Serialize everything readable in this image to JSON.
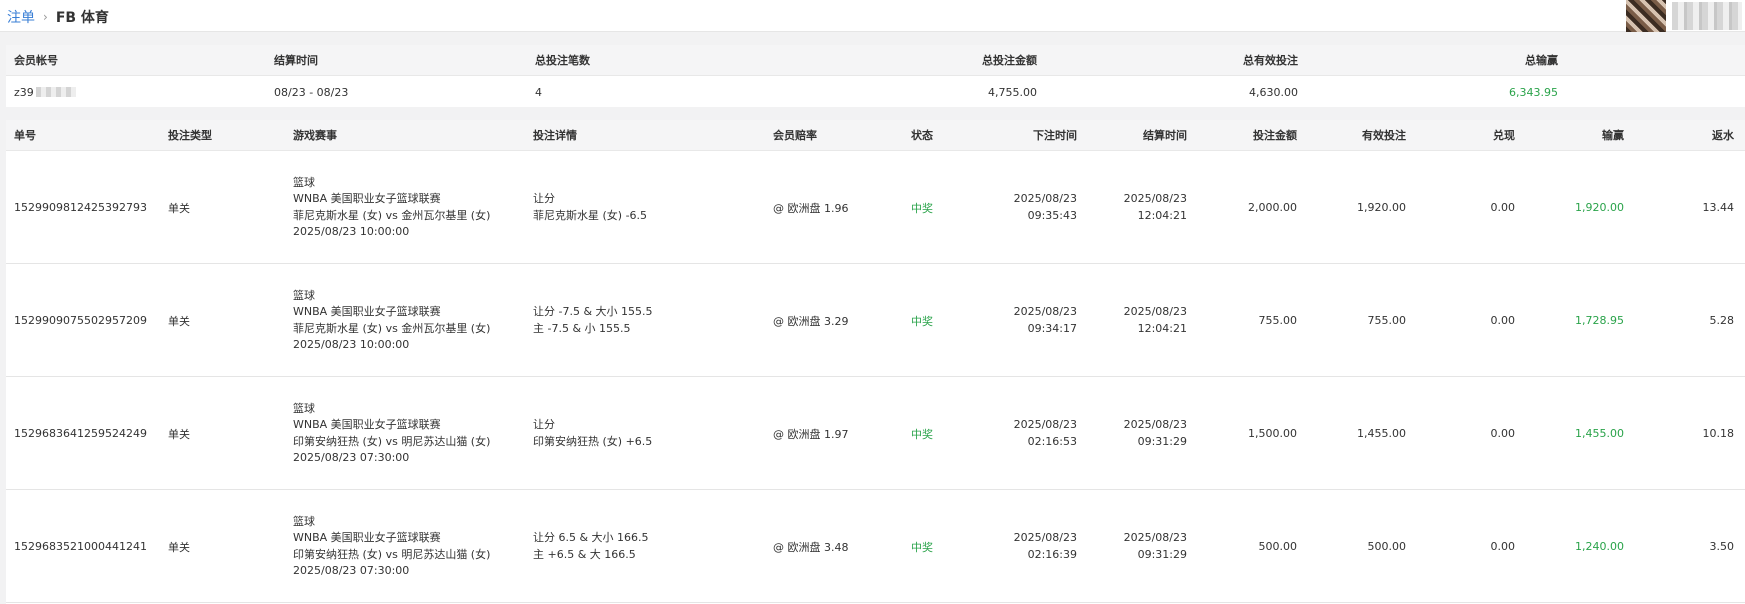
{
  "breadcrumb": {
    "parent": "注单",
    "separator": "›",
    "current": "FB 体育"
  },
  "summary": {
    "headers": {
      "account": "会员帐号",
      "settle_time": "结算时间",
      "total_bets": "总投注笔数",
      "total_amount": "总投注金额",
      "total_valid": "总有效投注",
      "total_winloss": "总输赢"
    },
    "row": {
      "account": "z39",
      "settle_time": "08/23 - 08/23",
      "total_bets": "4",
      "total_amount": "4,755.00",
      "total_valid": "4,630.00",
      "total_winloss": "6,343.95"
    }
  },
  "table": {
    "headers": {
      "id": "单号",
      "type": "投注类型",
      "event": "游戏赛事",
      "details": "投注详情",
      "odds": "会员赔率",
      "status": "状态",
      "bet_time": "下注时间",
      "settle_time": "结算时间",
      "amount": "投注金额",
      "valid": "有效投注",
      "cashout": "兑现",
      "winloss": "输赢",
      "rebate": "返水"
    },
    "rows": [
      {
        "id": "1529909812425392793",
        "type": "单关",
        "event": [
          "篮球",
          "WNBA 美国职业女子篮球联赛",
          "菲尼克斯水星 (女) vs 金州瓦尔基里 (女)",
          "2025/08/23 10:00:00"
        ],
        "details": [
          "让分",
          "菲尼克斯水星 (女) -6.5"
        ],
        "odds": "@ 欧洲盘 1.96",
        "status": "中奖",
        "bet_time": [
          "2025/08/23",
          "09:35:43"
        ],
        "settle_time": [
          "2025/08/23",
          "12:04:21"
        ],
        "amount": "2,000.00",
        "valid": "1,920.00",
        "cashout": "0.00",
        "winloss": "1,920.00",
        "rebate": "13.44"
      },
      {
        "id": "1529909075502957209",
        "type": "单关",
        "event": [
          "篮球",
          "WNBA 美国职业女子篮球联赛",
          "菲尼克斯水星 (女) vs 金州瓦尔基里 (女)",
          "2025/08/23 10:00:00"
        ],
        "details": [
          "让分 -7.5 & 大小 155.5",
          "主 -7.5 & 小 155.5"
        ],
        "odds": "@ 欧洲盘 3.29",
        "status": "中奖",
        "bet_time": [
          "2025/08/23",
          "09:34:17"
        ],
        "settle_time": [
          "2025/08/23",
          "12:04:21"
        ],
        "amount": "755.00",
        "valid": "755.00",
        "cashout": "0.00",
        "winloss": "1,728.95",
        "rebate": "5.28"
      },
      {
        "id": "1529683641259524249",
        "type": "单关",
        "event": [
          "篮球",
          "WNBA 美国职业女子篮球联赛",
          "印第安纳狂热 (女) vs 明尼苏达山猫 (女)",
          "2025/08/23 07:30:00"
        ],
        "details": [
          "让分",
          "印第安纳狂热 (女) +6.5"
        ],
        "odds": "@ 欧洲盘 1.97",
        "status": "中奖",
        "bet_time": [
          "2025/08/23",
          "02:16:53"
        ],
        "settle_time": [
          "2025/08/23",
          "09:31:29"
        ],
        "amount": "1,500.00",
        "valid": "1,455.00",
        "cashout": "0.00",
        "winloss": "1,455.00",
        "rebate": "10.18"
      },
      {
        "id": "1529683521000441241",
        "type": "单关",
        "event": [
          "篮球",
          "WNBA 美国职业女子篮球联赛",
          "印第安纳狂热 (女) vs 明尼苏达山猫 (女)",
          "2025/08/23 07:30:00"
        ],
        "details": [
          "让分 6.5 & 大小 166.5",
          "主 +6.5 & 大 166.5"
        ],
        "odds": "@ 欧洲盘 3.48",
        "status": "中奖",
        "bet_time": [
          "2025/08/23",
          "02:16:39"
        ],
        "settle_time": [
          "2025/08/23",
          "09:31:29"
        ],
        "amount": "500.00",
        "valid": "500.00",
        "cashout": "0.00",
        "winloss": "1,240.00",
        "rebate": "3.50"
      }
    ]
  },
  "colors": {
    "link": "#3a7fd6",
    "positive": "#2aa34a",
    "header_bg": "#f5f5f6"
  }
}
